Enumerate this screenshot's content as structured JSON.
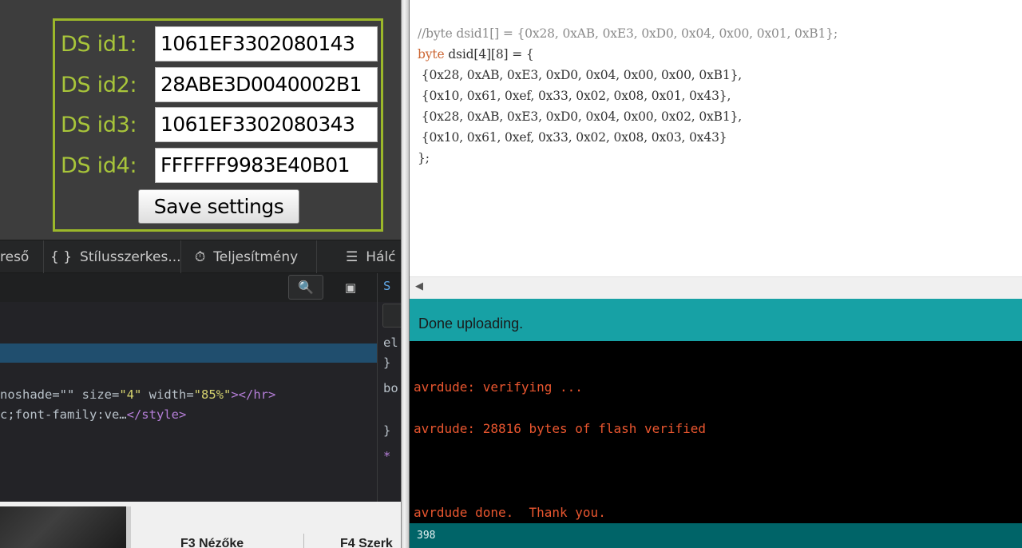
{
  "browser_page": {
    "ds_rows": [
      {
        "label": "DS id1:",
        "value": "1061EF3302080143"
      },
      {
        "label": "DS id2:",
        "value": "28ABE3D0040002B1"
      },
      {
        "label": "DS id3:",
        "value": "1061EF3302080343"
      },
      {
        "label": "DS id4:",
        "value": "FFFFFF9983E40B01"
      }
    ],
    "save_button": "Save settings"
  },
  "devtools": {
    "tabs": [
      {
        "label": "reső",
        "icon": ""
      },
      {
        "label": "Stílusszerkes...",
        "icon": "{ }"
      },
      {
        "label": "Teljesítmény",
        "icon": "⏱"
      },
      {
        "label": "Hálć",
        "icon": "☰"
      }
    ],
    "search_icon": "🔍",
    "dock_icon": "▣",
    "side_tab_label": "S",
    "markup_lines": {
      "hr_prefix": "noshade=\"\" ",
      "hr_size_attr": "size=",
      "hr_size_val": "\"4\"",
      "hr_width_attr": " width=",
      "hr_width_val": "\"85%\"",
      "hr_close": "></hr>",
      "style_text": "c;font-family:ve…",
      "style_close": "</style>"
    },
    "side_lines": [
      "el",
      "}",
      "bo",
      "}",
      "*"
    ]
  },
  "bottom_tabs": [
    "F3 Nézőke",
    "F4 Szerk"
  ],
  "arduino": {
    "code": {
      "comment": "//byte dsid1[] = {0x28, 0xAB, 0xE3, 0xD0, 0x04, 0x00, 0x01, 0xB1};",
      "decl_kw": "byte",
      "decl_rest": " dsid[4][8] = {",
      "rows": [
        " {0x28, 0xAB, 0xE3, 0xD0, 0x04, 0x00, 0x00, 0xB1},",
        " {0x10, 0x61, 0xef, 0x33, 0x02, 0x08, 0x01, 0x43},",
        " {0x28, 0xAB, 0xE3, 0xD0, 0x04, 0x00, 0x02, 0xB1},",
        " {0x10, 0x61, 0xef, 0x33, 0x02, 0x08, 0x03, 0x43}"
      ],
      "closing": "};"
    },
    "status": "Done uploading.",
    "console": [
      "avrdude: verifying ...",
      "avrdude: 28816 bytes of flash verified",
      "avrdude done.  Thank you."
    ],
    "line_number": "398"
  }
}
